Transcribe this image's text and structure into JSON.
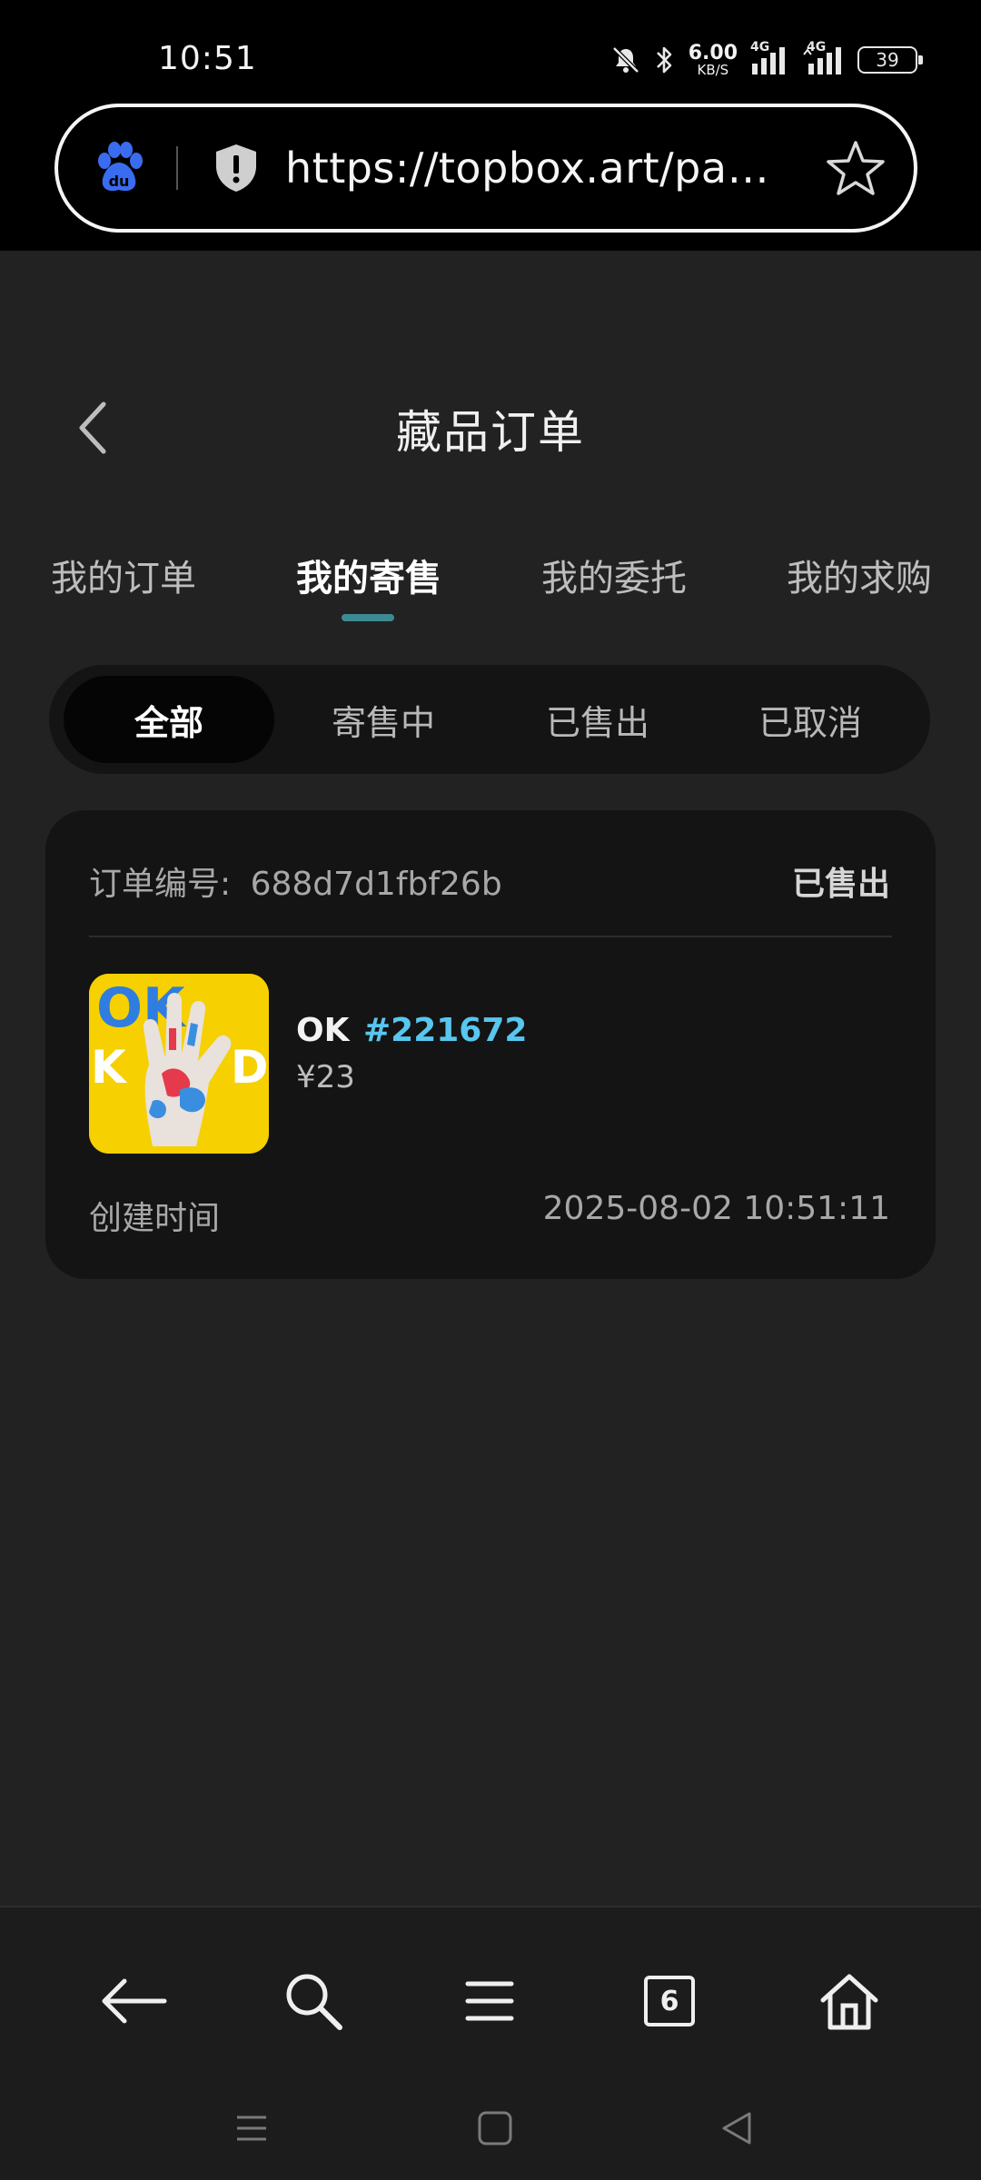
{
  "status_bar": {
    "time": "10:51",
    "net_speed_value": "6.00",
    "net_speed_unit": "KB/S",
    "signal_1_label": "4G",
    "signal_2_label": "4G",
    "battery": "39",
    "icons": [
      "mute-icon",
      "bluetooth-icon",
      "signal-icon",
      "signal-icon",
      "battery-icon"
    ]
  },
  "browser": {
    "url": "https://topbox.art/pages/order",
    "url_display": "https://topbox.art/page…",
    "logo_text": "du",
    "icons": [
      "baidu-paw-icon",
      "shield-icon",
      "star-icon"
    ]
  },
  "header": {
    "title": "藏品订单"
  },
  "tabs": [
    {
      "label": "我的订单",
      "active": false
    },
    {
      "label": "我的寄售",
      "active": true
    },
    {
      "label": "我的委托",
      "active": false
    },
    {
      "label": "我的求购",
      "active": false
    }
  ],
  "filters": [
    {
      "label": "全部",
      "active": true
    },
    {
      "label": "寄售中",
      "active": false
    },
    {
      "label": "已售出",
      "active": false
    },
    {
      "label": "已取消",
      "active": false
    }
  ],
  "order": {
    "number_label": "订单编号:",
    "number": "688d7d1fbf26b",
    "status": "已售出",
    "item_name": "OK",
    "item_tag": "#221672",
    "price": "¥23",
    "created_label": "创建时间",
    "created_time": "2025-08-02 10:51:11",
    "thumb_text": "OK"
  },
  "bottom_nav": {
    "tab_count": "6",
    "icons": [
      "back-arrow-icon",
      "search-icon",
      "menu-icon",
      "tabs-icon",
      "home-icon"
    ]
  },
  "system_nav": {
    "icons": [
      "recent-apps-icon",
      "home-square-icon",
      "back-triangle-icon"
    ]
  },
  "colors": {
    "background": "#222222",
    "card": "#141414",
    "accent_indicator": "#3d8a94",
    "tag_blue": "#58c6ee"
  }
}
